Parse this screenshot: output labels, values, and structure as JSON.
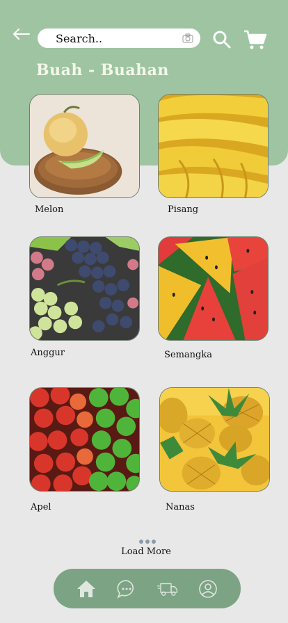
{
  "header": {
    "search_placeholder": "Search..",
    "title": "Buah - Buahan"
  },
  "products": [
    {
      "name": "Melon",
      "image": "melon-photo"
    },
    {
      "name": "Pisang",
      "image": "banana-photo"
    },
    {
      "name": "Anggur",
      "image": "grapes-photo"
    },
    {
      "name": "Semangka",
      "image": "watermelon-photo"
    },
    {
      "name": "Apel",
      "image": "apples-photo"
    },
    {
      "name": "Nanas",
      "image": "pineapple-photo"
    }
  ],
  "load_more": "Load More",
  "nav": {
    "items": [
      "home-icon",
      "chat-icon",
      "delivery-truck-icon",
      "profile-icon"
    ]
  },
  "colors": {
    "header_bg": "#9ec4a2",
    "page_bg": "#e8e8e8",
    "nav_bg": "#7da385",
    "title": "#f3f8e8"
  }
}
